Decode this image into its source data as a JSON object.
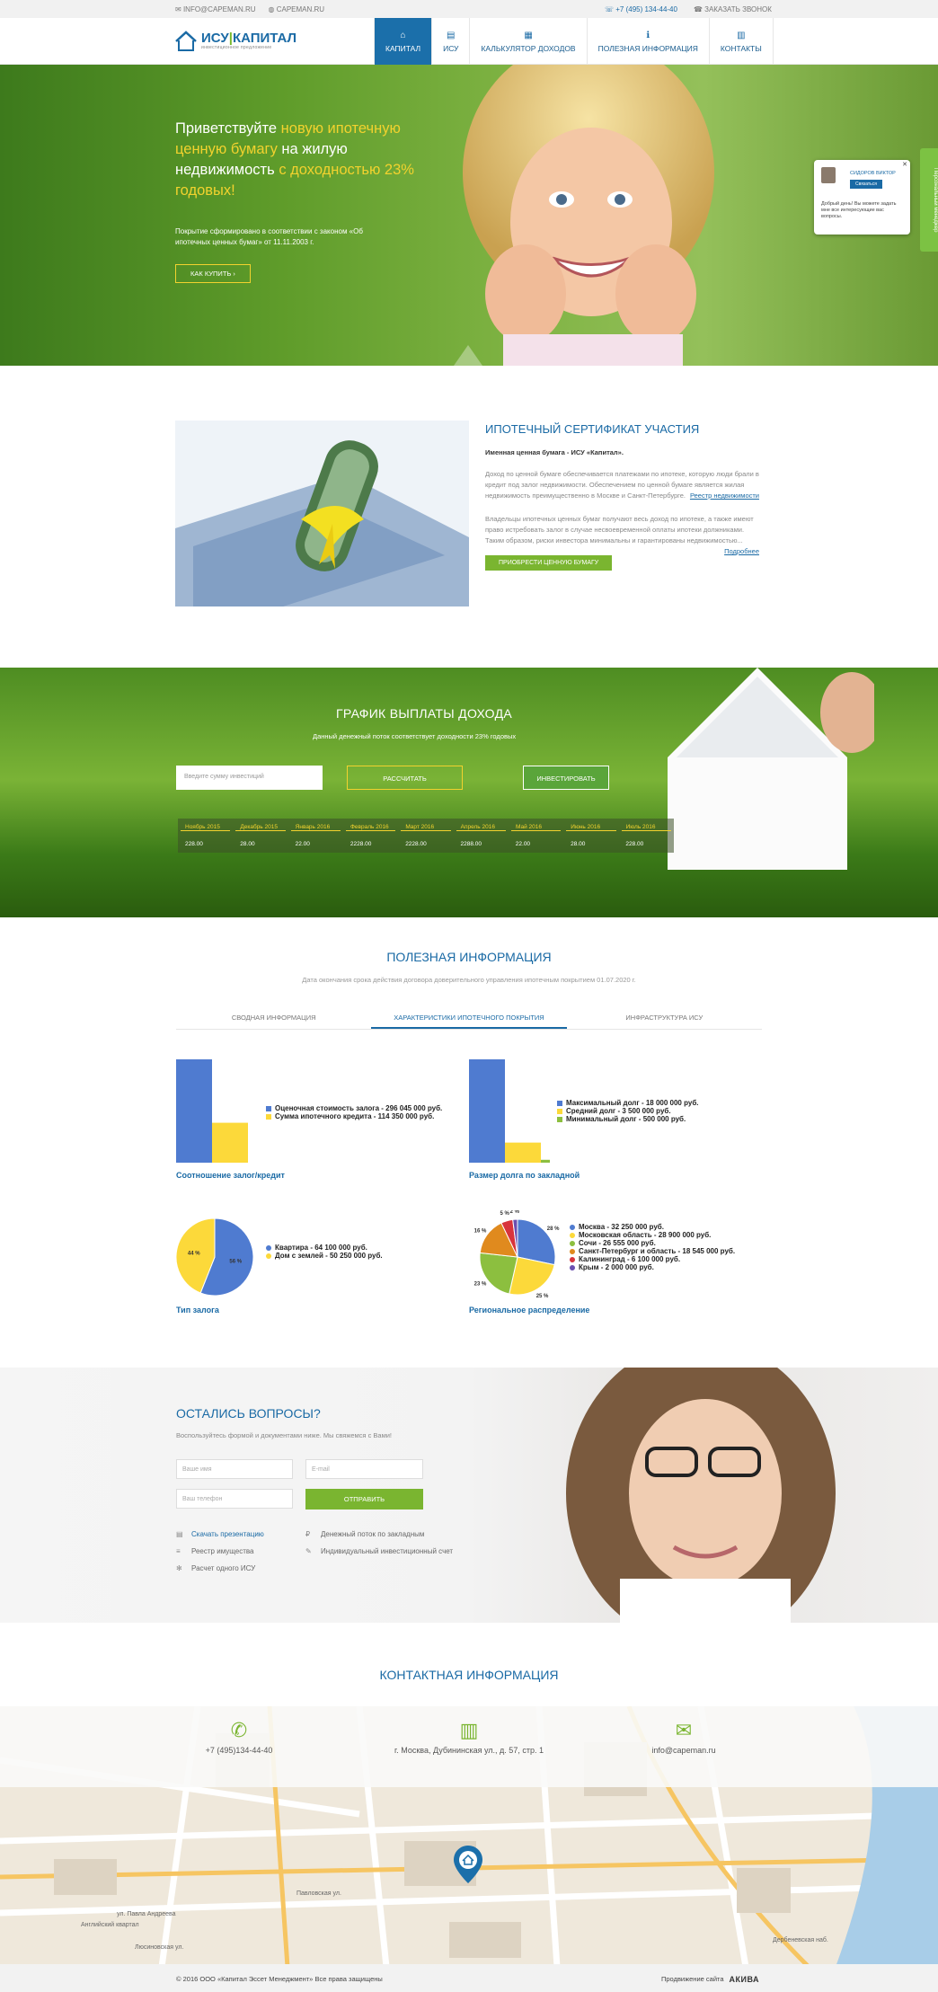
{
  "topbar": {
    "email": "INFO@CAPEMAN.RU",
    "site": "CAPEMAN.RU",
    "phone": "+7 (495) 134-44-40",
    "callback": "ЗАКАЗАТЬ ЗВОНОК"
  },
  "logo": {
    "name_left": "ИСУ",
    "name_right": "КАПИТАЛ",
    "tagline": "инвестиционное предложение"
  },
  "nav": [
    {
      "label": "КАПИТАЛ",
      "icon": "home-icon"
    },
    {
      "label": "ИСУ",
      "icon": "doc-icon"
    },
    {
      "label": "КАЛЬКУЛЯТОР ДОХОДОВ",
      "icon": "calculator-icon"
    },
    {
      "label": "ПОЛЕЗНАЯ ИНФОРМАЦИЯ",
      "icon": "info-icon"
    },
    {
      "label": "КОНТАКТЫ",
      "icon": "map-icon"
    }
  ],
  "hero": {
    "t1": "Приветствуйте ",
    "t2": "новую ипотечную ценную бумагу",
    "t3": " на жилую недвижимость ",
    "t4": "с доходностью 23% годовых!",
    "desc": "Покрытие сформировано в соответствии с законом «Об ипотечных ценных бумаг» от 11.11.2003 г.",
    "button": "КАК КУПИТЬ"
  },
  "chat": {
    "name": "СИДОРОВ ВИКТОР",
    "call": "Связаться",
    "message": "Добрый день! Вы можете задать мне все интересующие вас вопросы.",
    "side_tab": "Персональный менеджер"
  },
  "cert": {
    "title": "ИПОТЕЧНЫЙ СЕРТИФИКАТ УЧАСТИЯ",
    "subtitle": "Именная ценная бумага - ИСУ «Капитал».",
    "p1": "Доход по ценной бумаге обеспечивается платежами по ипотеке, которую люди брали в кредит под залог недвижимости. Обеспечением по ценной бумаге является жилая недвижимость преимущественно в Москве и Санкт-Петербурге.",
    "link1": "Реестр недвижимости",
    "p2": "Владельцы ипотечных ценных бумаг получают весь доход по ипотеке, а также имеют право истребовать залог в случае несвоевременной оплаты ипотеки должниками. Таким образом, риски инвестора минимальны и гарантированы недвижимостью...",
    "link2": "Подробнее",
    "button": "ПРИОБРЕСТИ ЦЕННУЮ БУМАГУ"
  },
  "schedule": {
    "title": "ГРАФИК ВЫПЛАТЫ ДОХОДА",
    "subtitle": "Данный денежный поток соответствует доходности 23% годовых",
    "input_placeholder": "Введите сумму инвестиций",
    "calc_button": "РАССЧИТАТЬ",
    "invest_button": "ИНВЕСТИРОВАТЬ",
    "months": [
      "Ноябрь 2015",
      "Декабрь 2015",
      "Январь 2016",
      "Февраль 2016",
      "Март 2016",
      "Апрель 2016",
      "Май 2016",
      "Июнь 2016",
      "Июль 2016"
    ],
    "values": [
      "228.00",
      "28.00",
      "22.00",
      "2228.00",
      "2228.00",
      "2288.00",
      "22.00",
      "28.00",
      "228.00"
    ]
  },
  "useful": {
    "title": "ПОЛЕЗНАЯ ИНФОРМАЦИЯ",
    "date": "Дата окончания срока действия договора доверительного управления ипотечным покрытием 01.07.2020 г.",
    "tabs": [
      "СВОДНАЯ ИНФОРМАЦИЯ",
      "ХАРАКТЕРИСТИКИ ИПОТЕЧНОГО ПОКРЫТИЯ",
      "ИНФРАСТРУКТУРА ИСУ"
    ]
  },
  "chart_data": [
    {
      "type": "bar",
      "title": "Соотношение залог/кредит",
      "series": [
        {
          "name": "Оценочная стоимость залога - 296 045 000 руб.",
          "values": [
            296045000
          ],
          "color": "#4f7bd0"
        },
        {
          "name": "Сумма ипотечного кредита - 114 350 000 руб.",
          "values": [
            114350000
          ],
          "color": "#fcd93a"
        }
      ]
    },
    {
      "type": "bar",
      "title": "Размер долга по закладной",
      "series": [
        {
          "name": "Максимальный долг - 18 000 000 руб.",
          "values": [
            18000000
          ],
          "color": "#4f7bd0"
        },
        {
          "name": "Средний долг - 3 500 000 руб.",
          "values": [
            3500000
          ],
          "color": "#fcd93a"
        },
        {
          "name": "Минимальный долг - 500 000 руб.",
          "values": [
            500000
          ],
          "color": "#8cbf3f"
        }
      ]
    },
    {
      "type": "pie",
      "title": "Тип залога",
      "labels": [
        "56 %",
        "44 %"
      ],
      "values": [
        56,
        44
      ],
      "legend": [
        "Квартира - 64 100 000 руб.",
        "Дом с землей - 50 250 000 руб."
      ],
      "colors": [
        "#4f7bd0",
        "#fcd93a"
      ]
    },
    {
      "type": "pie",
      "title": "Региональное распределение",
      "labels": [
        "28 %",
        "25 %",
        "23 %",
        "16 %",
        "5 %",
        "2 %"
      ],
      "values": [
        28,
        25,
        23,
        16,
        5,
        2
      ],
      "legend": [
        "Москва - 32 250 000 руб.",
        "Московская область - 28 900 000 руб.",
        "Сочи - 26 555 000 руб.",
        "Санкт-Петербург и область - 18 545 000 руб.",
        "Калининград - 6 100 000 руб.",
        "Крым - 2 000 000 руб."
      ],
      "colors": [
        "#4f7bd0",
        "#fcd93a",
        "#8cbf3f",
        "#e08a1e",
        "#d8343c",
        "#6b4fb0"
      ]
    }
  ],
  "questions": {
    "title": "ОСТАЛИСЬ ВОПРОСЫ?",
    "subtitle": "Воспользуйтесь формой и документами ниже. Мы свяжемся с Вами!",
    "name_ph": "Ваше имя",
    "email_ph": "E-mail",
    "phone_ph": "Ваш телефон",
    "submit": "ОТПРАВИТЬ",
    "links": [
      "Скачать презентацию",
      "Реестр имущества",
      "Расчет одного ИСУ",
      "Денежный поток по закладным",
      "Индивидуальный инвестиционный счет"
    ]
  },
  "contacts": {
    "title": "КОНТАКТНАЯ ИНФОРМАЦИЯ",
    "phone": "+7 (495)134-44-40",
    "address": "г. Москва, Дубининская ул., д. 57, стр. 1",
    "email": "info@capeman.ru",
    "map_labels": [
      "Английский квартал",
      "ул. Павла Андреева",
      "Павловская ул.",
      "Люсиновская ул.",
      "Дербеневская наб."
    ]
  },
  "footer": {
    "copyright": "© 2016 ООО «Капитал Эссет Менеджмент» Все права защищены",
    "promo": "Продвижение сайта",
    "brand": "АКИВА"
  }
}
